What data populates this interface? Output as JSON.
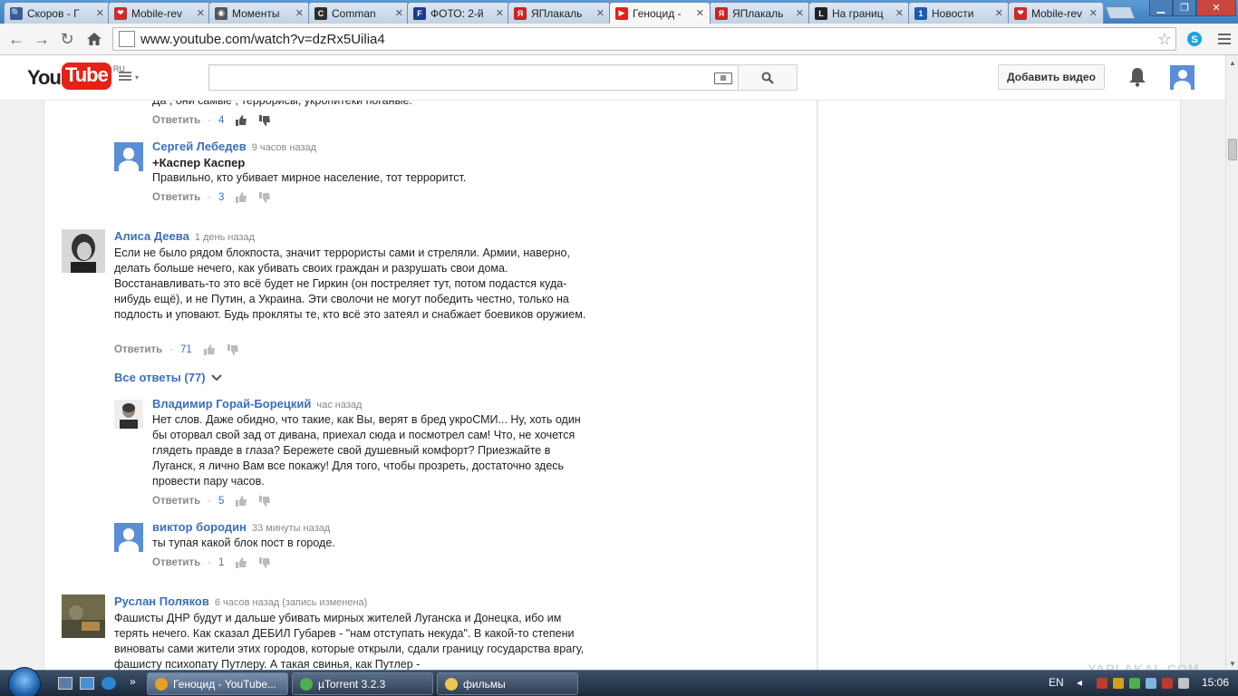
{
  "browser": {
    "tabs": [
      {
        "title": "Скоров - Г",
        "favicon_color": "#3b5998",
        "glyph": "🔍"
      },
      {
        "title": "Mobile-rev",
        "favicon_color": "#cc2b2b",
        "glyph": "❤"
      },
      {
        "title": "Моменты",
        "favicon_color": "#555555",
        "glyph": "◉"
      },
      {
        "title": "Comman",
        "favicon_color": "#2d2d2d",
        "glyph": "C"
      },
      {
        "title": "ФОТО: 2-й",
        "favicon_color": "#1a3c8e",
        "glyph": "F"
      },
      {
        "title": "ЯПлакаль",
        "favicon_color": "#cc2222",
        "glyph": "Я"
      },
      {
        "title": "Геноцид -",
        "favicon_color": "#e62117",
        "glyph": "▶"
      },
      {
        "title": "ЯПлакаль",
        "favicon_color": "#cc2222",
        "glyph": "Я"
      },
      {
        "title": "На границ",
        "favicon_color": "#222222",
        "glyph": "L"
      },
      {
        "title": "Новости",
        "favicon_color": "#1e5aa8",
        "glyph": "1"
      },
      {
        "title": "Mobile-rev",
        "favicon_color": "#cc2b2b",
        "glyph": "❤"
      }
    ],
    "active_tab_index": 6,
    "url": "www.youtube.com/watch?v=dzRx5Uilia4"
  },
  "youtube": {
    "logo_you": "You",
    "logo_tube": "Tube",
    "logo_region": "RU",
    "upload_label": "Добавить видео",
    "search_placeholder": ""
  },
  "comments": {
    "partial_top": {
      "text": "Да , они самые , террорисы, укропитеки поганые.",
      "reply": "Ответить",
      "likes": "4"
    },
    "lebedev": {
      "author": "Сергей Лебедев",
      "time": "9 часов назад",
      "mention": "+Каспер Каспер",
      "text": "Правильно, кто убивает мирное население, тот терроритст.",
      "reply": "Ответить",
      "likes": "3"
    },
    "deeva": {
      "author": "Алиса Деева",
      "time": "1 день назад",
      "text": "Если не было рядом блокпоста, значит террористы сами и стреляли. Армии, наверно, делать больше нечего, как убивать своих граждан и разрушать свои дома. Восстанавливать-то это всё будет не Гиркин (он постреляет тут, потом подастся куда-нибудь ещё), и не Путин, а Украина. Эти сволочи не могут победить честно, только на подлость и уповают. Будь прокляты те, кто всё это затеял и снабжает боевиков оружием.",
      "reply": "Ответить",
      "likes": "71",
      "all_replies": "Все ответы (77)"
    },
    "borecky": {
      "author": "Владимир Горай-Борецкий",
      "time": "час назад",
      "text": "Нет слов. Даже обидно, что такие, как Вы, верят в бред укроСМИ... Ну, хоть один бы оторвал свой зад от дивана, приехал сюда и посмотрел сам! Что, не хочется глядеть правде в глаза? Бережете свой душевный комфорт? Приезжайте в Луганск, я лично Вам все покажу! Для того, чтобы прозреть, достаточно здесь провести пару часов.",
      "reply": "Ответить",
      "likes": "5"
    },
    "borodin": {
      "author": "виктор бородин",
      "time": "33 минуты назад",
      "text": "ты тупая какой блок пост в городе.",
      "reply": "Ответить",
      "likes": "1"
    },
    "polyakov": {
      "author": "Руслан Поляков",
      "time": "6 часов назад (запись изменена)",
      "text": "Фашисты ДНР будут и дальше убивать мирных жителей Луганска и Донецка, ибо им терять нечего. Как сказал ДЕБИЛ Губарев - \"нам отступать некуда\". В какой-то степени виноваты сами жители этих городов, которые открыли, сдали границу государства врагу, фашисту психопату Путлеру. А такая свинья, как Путлер -"
    }
  },
  "taskbar": {
    "buttons": [
      {
        "label": "Геноцид - YouTube...",
        "icon_color": "#e8a020"
      },
      {
        "label": "µTorrent 3.2.3",
        "icon_color": "#4caf50"
      },
      {
        "label": "фильмы",
        "icon_color": "#e8c850"
      }
    ],
    "lang": "EN",
    "clock": "15:06"
  },
  "watermark": "YAPLAKAL.COM"
}
